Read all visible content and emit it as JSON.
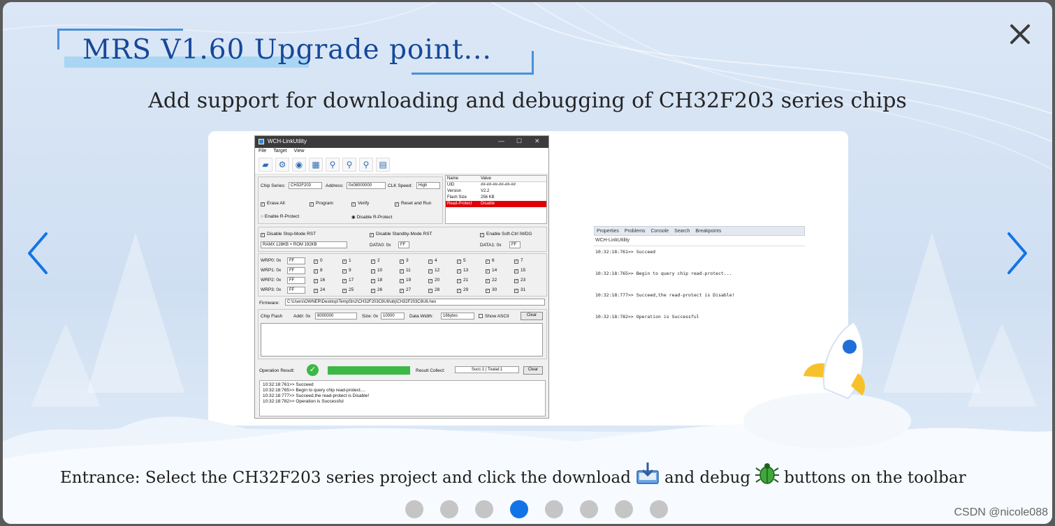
{
  "modal": {
    "title": "MRS V1.60 Upgrade point...",
    "subtitle": "Add support for downloading and debugging of CH32F203 series chips",
    "entrance": {
      "before_download": "Entrance: Select the CH32F203 series project and click the download",
      "between": "and debug",
      "after_debug": "buttons on the toolbar",
      "download_icon": "download-icon",
      "debug_icon": "debug-bug-icon"
    },
    "close_icon": "close-icon",
    "prev_icon": "chevron-left-icon",
    "next_icon": "chevron-right-icon",
    "pagination": {
      "total": 8,
      "active_index": 3
    },
    "accent_color": "#1273e6",
    "title_color": "#16489a"
  },
  "linkutility": {
    "window_title": "WCH-LinkUtility",
    "menu": [
      "File",
      "Target",
      "View"
    ],
    "chip_series_label": "Chip Series:",
    "chip_series_value": "CH32F203",
    "address_label": "Address:",
    "address_value": "0x08000000",
    "clk_label": "CLK Speed:",
    "clk_value": "High",
    "options": [
      "Erase All",
      "Program",
      "Verify",
      "Reset and Run"
    ],
    "enable_rprotect": "Enable  R-Protect",
    "disable_rprotect": "Disable  R-Protect",
    "props_header": [
      "Name",
      "Value"
    ],
    "props": [
      {
        "k": "UID",
        "v": "##-##-##-##-##-##"
      },
      {
        "k": "Version",
        "v": "V2.2"
      },
      {
        "k": "Flash Size",
        "v": "256 KB"
      },
      {
        "k": "Read-Protect",
        "v": "Disable"
      }
    ],
    "stop_mode": "Disable Stop-Mode RST",
    "standby_mode": "Disable Standby-Mode RST",
    "soft_iwdg": "Enable Soft-Ctrl IWDG",
    "ram_rom": "RAMX 128KB + ROM 192KB",
    "data0_label": "DATA0: 0x",
    "data0_value": "FF",
    "data1_label": "DATA1: 0x",
    "data1_value": "FF",
    "wrp": [
      {
        "label": "WRP0: 0x",
        "value": "FF",
        "bits": [
          "0",
          "1",
          "2",
          "3",
          "4",
          "5",
          "6",
          "7"
        ]
      },
      {
        "label": "WRP1: 0x",
        "value": "FF",
        "bits": [
          "8",
          "9",
          "10",
          "11",
          "12",
          "13",
          "14",
          "15"
        ]
      },
      {
        "label": "WRP2: 0x",
        "value": "FF",
        "bits": [
          "16",
          "17",
          "18",
          "19",
          "20",
          "21",
          "22",
          "23"
        ]
      },
      {
        "label": "WRP3: 0x",
        "value": "FF",
        "bits": [
          "24",
          "25",
          "26",
          "27",
          "28",
          "29",
          "30",
          "31"
        ]
      }
    ],
    "firmware_label": "Firmware:",
    "firmware_path": "C:\\Users\\OWNER\\Desktop\\TempSln2\\CH32F203C8U6\\obj\\CH32F203C8U6.hex",
    "chip_flash": "Chip Flash",
    "addr_label": "Addr: 0x",
    "addr_value": "8000000",
    "size_label": "Size: 0x",
    "size_value": "10000",
    "data_width_label": "Data Width:",
    "data_width_value": "16bytes",
    "show_ascii": "Show ASCII",
    "clear": "Clear",
    "operation_result": "Operation Result:",
    "result_collect": "Result Collect:",
    "result_value": "Succ:1 | Toatal:1",
    "clear2": "Clear",
    "log": [
      "10:32:18:761>> Succeed",
      "10:32:18:765>> Begin to query chip read-protect....",
      "10:32:18:777>> Succeed,the read-protect is Disable!",
      "10:32:18:782>> Operation is Successful"
    ]
  },
  "console": {
    "tabs": [
      "Properties",
      "Problems",
      "Console",
      "Search",
      "Breakpoints"
    ],
    "title": "WCH-LinkUtility",
    "lines": [
      "10:32:18:761>> Succeed",
      "10:32:18:765>> Begin to query chip read-protect...",
      "10:32:18:777>> Succeed,the read-protect is Disable!",
      "10:32:18:782>> Operation is Successful"
    ]
  },
  "watermark": "CSDN @nicole088"
}
